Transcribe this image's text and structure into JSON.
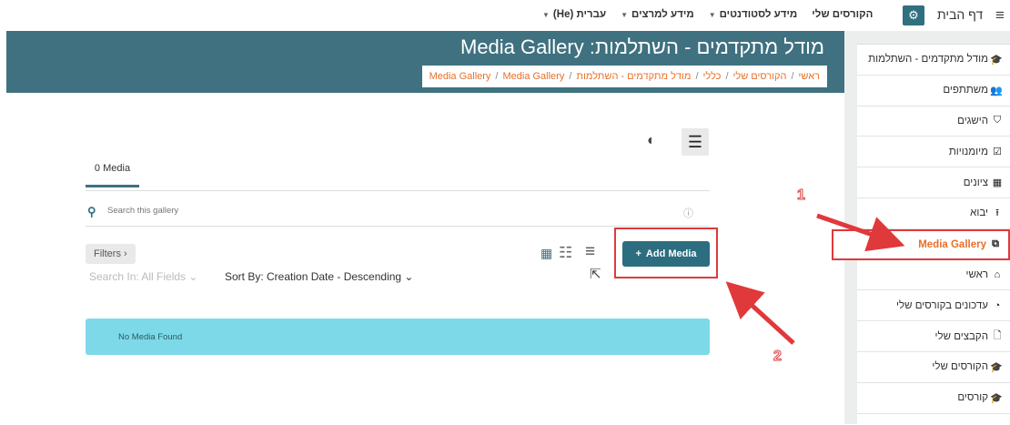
{
  "topbar": {
    "menu_icon": "hamburger-icon",
    "home": "דף הבית",
    "settings_icon": "cogs-icon",
    "nav": [
      {
        "label": "הקורסים שלי",
        "caret": false
      },
      {
        "label": "מידע לסטודנטים",
        "caret": true
      },
      {
        "label": "מידע למרצים",
        "caret": true
      },
      {
        "label": "עברית (He)",
        "caret": true
      }
    ]
  },
  "header": {
    "title": "מודל מתקדמים - השתלמות: Media Gallery",
    "breadcrumb": [
      "ראשי",
      "הקורסים שלי",
      "כללי",
      "מודל מתקדמים - השתלמות",
      "Media Gallery",
      "Media Gallery"
    ],
    "separator": "/"
  },
  "sidebar": {
    "items": [
      {
        "icon": "graduation-cap-icon",
        "glyph": "🎓",
        "label": "מודל מתקדמים - השתלמות",
        "active": false
      },
      {
        "icon": "users-icon",
        "glyph": "👥",
        "label": "משתתפים",
        "active": false
      },
      {
        "icon": "shield-icon",
        "glyph": "⛉",
        "label": "הישגים",
        "active": false
      },
      {
        "icon": "check-square-icon",
        "glyph": "☑",
        "label": "מיומנויות",
        "active": false
      },
      {
        "icon": "table-icon",
        "glyph": "▦",
        "label": "ציונים",
        "active": false
      },
      {
        "icon": "upload-icon",
        "glyph": "⭱",
        "label": "יבוא",
        "active": false
      },
      {
        "icon": "gallery-icon",
        "glyph": "⧉",
        "label": "Media Gallery",
        "active": true
      },
      {
        "icon": "home-icon",
        "glyph": "⌂",
        "label": "ראשי",
        "active": false
      },
      {
        "icon": "dashboard-icon",
        "glyph": "◔",
        "label": "עדכונים בקורסים שלי",
        "active": false
      },
      {
        "icon": "file-icon",
        "glyph": "🗋",
        "label": "הקבצים שלי",
        "active": false
      },
      {
        "icon": "graduation-cap-icon",
        "glyph": "🎓",
        "label": "הקורסים שלי",
        "active": false
      },
      {
        "icon": "graduation-cap-icon",
        "glyph": "🎓",
        "label": "קורסים",
        "active": false
      }
    ]
  },
  "main": {
    "tab": "0 Media",
    "search_placeholder": "Search this gallery",
    "filters": "Filters ›",
    "search_in": "Search In: All Fields ⌄",
    "sort_by": "Sort By: Creation Date - Descending ⌄",
    "add_media": "Add Media",
    "empty_message": "No Media Found"
  },
  "annotations": {
    "label_1": "1",
    "label_2": "2",
    "color": "#e0393c"
  }
}
